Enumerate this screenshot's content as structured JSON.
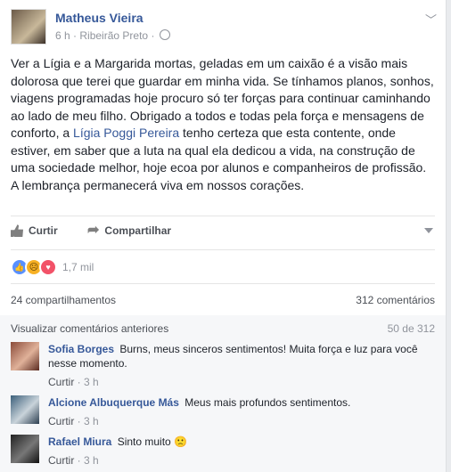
{
  "post": {
    "author": "Matheus Vieira",
    "time": "6 h",
    "location": "Ribeirão Preto",
    "separator": "·",
    "text_before": "Ver a Lígia e a Margarida mortas, geladas em um caixão é a visão mais dolorosa que terei que guardar em minha vida. Se tínhamos planos, sonhos, viagens programadas hoje procuro só ter forças para continuar caminhando ao lado de meu filho. Obrigado a todos e todas pela força e mensagens de conforto, a ",
    "mention": "Lígia Poggi Pereira",
    "text_after": " tenho certeza que esta contente, onde estiver, em saber que a luta na qual ela dedicou a vida, na construção de uma sociedade melhor, hoje ecoa por alunos e companheiros de profissão. A lembrança permanecerá viva em nossos corações."
  },
  "actions": {
    "like": "Curtir",
    "share": "Compartilhar"
  },
  "reactions": {
    "count": "1,7 mil"
  },
  "stats": {
    "shares": "24 compartilhamentos",
    "comments": "312 comentários"
  },
  "comments_section": {
    "view_previous": "Visualizar comentários anteriores",
    "pagination": "50 de 312",
    "items": [
      {
        "name": "Sofia Borges",
        "text": "Burns, meus sinceros sentimentos! Muita força e luz para você nesse momento.",
        "like": "Curtir",
        "time": "3 h"
      },
      {
        "name": "Alcione Albuquerque Más",
        "text": "Meus mais profundos sentimentos.",
        "like": "Curtir",
        "time": "3 h"
      },
      {
        "name": "Rafael Miura",
        "text": "Sinto muito 🙁",
        "like": "Curtir",
        "time": "3 h"
      }
    ]
  }
}
